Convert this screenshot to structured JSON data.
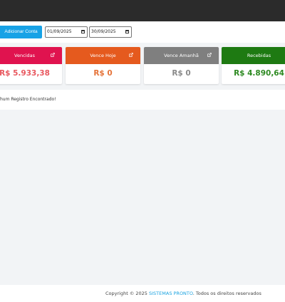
{
  "toolbar": {
    "add_button_label": "Adicionar Conta",
    "date_start": "01/09/2025",
    "date_end": "30/09/2025"
  },
  "cards": [
    {
      "label": "Vencidas",
      "value": "R$ 5.933,38",
      "header_color": "#e0134f",
      "value_color": "#e8585f",
      "icon": "external-link-icon"
    },
    {
      "label": "Vence Hoje",
      "value": "R$ 0",
      "header_color": "#e55a1e",
      "value_color": "#e5743a",
      "icon": "external-link-icon"
    },
    {
      "label": "Vence Amanhã",
      "value": "R$ 0",
      "header_color": "#7f7f7f",
      "value_color": "#8a8a8a",
      "icon": "external-link-icon"
    },
    {
      "label": "Recebidas",
      "value": "R$ 4.890,64",
      "header_color": "#1e7a12",
      "value_color": "#2e8a22",
      "icon": "external-link-icon"
    }
  ],
  "table": {
    "empty_message": "Nenhum Registro Encontrado!"
  },
  "footer": {
    "prefix": "Copyright © 2025 ",
    "brand": "SISTEMAS PRONTO",
    "suffix": ". Todos os direitos reservados"
  }
}
